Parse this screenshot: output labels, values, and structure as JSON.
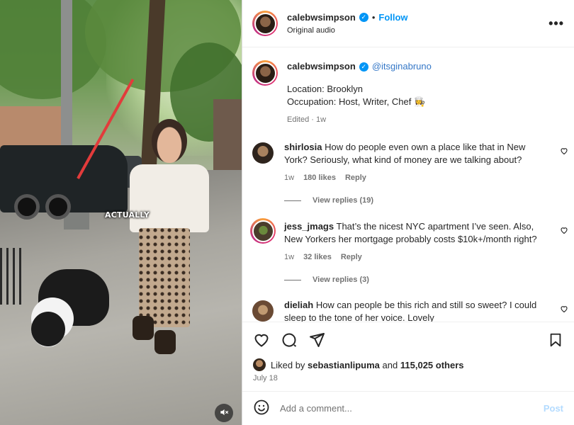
{
  "post_author": {
    "username": "calebwsimpson",
    "verified": true,
    "follow_label": "Follow",
    "separator": "•",
    "audio": "Original audio"
  },
  "media": {
    "burned_text": "ACTUALLY",
    "mute_icon": "muted-speaker-icon"
  },
  "caption": {
    "username": "calebwsimpson",
    "mention": "@itsginabruno",
    "line1": "Location: Brooklyn",
    "line2": "Occupation: Host, Writer, Chef 👩‍🍳",
    "edited": "Edited",
    "time": "1w"
  },
  "comments": [
    {
      "username": "shirlosia",
      "text": "How do people even own a place like that in New York? Seriously, what kind of money are we talking about?",
      "time": "1w",
      "likes": "180 likes",
      "reply": "Reply",
      "view_replies": "View replies (19)"
    },
    {
      "username": "jess_jmags",
      "text": "That’s the nicest NYC apartment I’ve seen. Also, New Yorkers her mortgage probably costs $10k+/month right?",
      "time": "1w",
      "likes": "32 likes",
      "reply": "Reply",
      "view_replies": "View replies (3)"
    },
    {
      "username": "dieliah",
      "text": "How can people be this rich and still so sweet? I could sleep to the tone of her voice. Lovely"
    }
  ],
  "engagement": {
    "liked_by_prefix": "Liked by",
    "liked_by_user": "sebastianlipuma",
    "liked_by_and": "and",
    "others": "115,025 others",
    "date": "July 18"
  },
  "add_comment": {
    "placeholder": "Add a comment...",
    "post_label": "Post"
  },
  "colors": {
    "accent_blue": "#0095f6",
    "mention_blue": "#3477c7",
    "muted_text": "#737373"
  }
}
